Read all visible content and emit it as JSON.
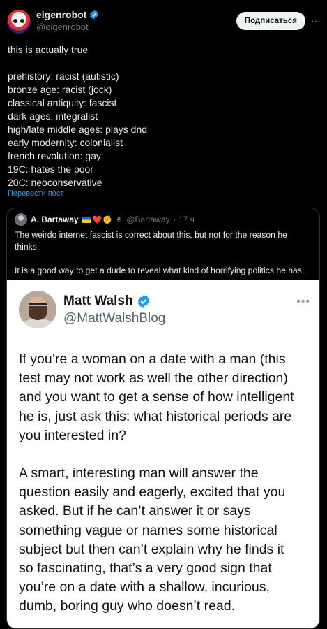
{
  "author": {
    "name": "eigenrobot",
    "handle": "@eigenrobot",
    "subscribe_label": "Подписаться",
    "more_label": "⋯"
  },
  "tweet": {
    "lines": [
      "this is actually true",
      "",
      "prehistory: racist (autistic)",
      "bronze age: racist (jock)",
      "classical antiquity: fascist",
      "dark ages: integralist",
      "high/late middle ages: plays dnd",
      "early modernity: colonialist",
      "french revolution: gay",
      "19C: hates the poor",
      "20C: neoconservative"
    ],
    "translate_label": "Перевести пост"
  },
  "quote": {
    "name": "A. Bartaway",
    "emoji": "❤️✊ ✌",
    "handle": "@Bartaway",
    "time": "· 17 ч",
    "paragraphs": [
      "The weirdo internet fascist is correct about this, but not for the reason he thinks.",
      "It is a good way to get a dude to reveal what kind of horrifying politics he has."
    ]
  },
  "embedded": {
    "name": "Matt Walsh",
    "handle": "@MattWalshBlog",
    "more_label": "•••",
    "lines": [
      "If you’re a woman on a date with a man (this",
      "test may not work as well the other direction)",
      "and you want to get a sense of how intelligent",
      "he is, just ask this: what historical periods are",
      "you interested in?",
      "",
      "A smart, interesting man will answer the",
      "question easily and eagerly, excited that you",
      "asked. But if he can’t answer it or says",
      "something vague or names some historical",
      "subject but then can’t explain why he finds it",
      "so fascinating, that’s a very good sign that",
      "you’re on a date with a shallow, incurious,",
      "dumb, boring guy who doesn’t read."
    ]
  },
  "colors": {
    "background": "#000000",
    "accent": "#1d9bf0",
    "muted": "#71767b"
  }
}
